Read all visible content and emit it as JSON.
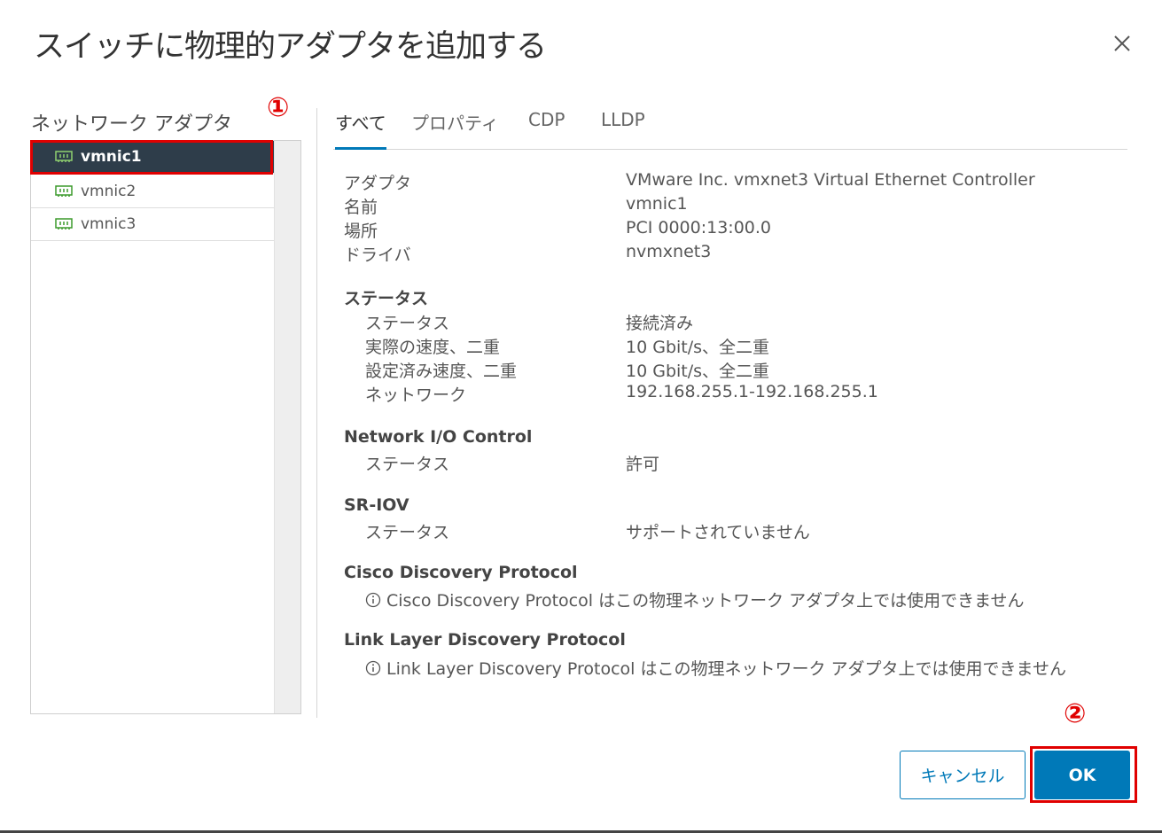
{
  "dialog": {
    "title": "スイッチに物理的アダプタを追加する"
  },
  "left": {
    "label": "ネットワーク アダプタ",
    "adapters": [
      {
        "name": "vmnic1",
        "selected": true
      },
      {
        "name": "vmnic2",
        "selected": false
      },
      {
        "name": "vmnic3",
        "selected": false
      }
    ]
  },
  "annotations": {
    "one": "①",
    "two": "②",
    "color": "#e00000"
  },
  "tabs": [
    "すべて",
    "プロパティ",
    "CDP",
    "LLDP"
  ],
  "details": {
    "general": [
      {
        "k": "アダプタ",
        "v": "VMware Inc. vmxnet3 Virtual Ethernet Controller"
      },
      {
        "k": "名前",
        "v": "vmnic1"
      },
      {
        "k": "場所",
        "v": "PCI 0000:13:00.0"
      },
      {
        "k": "ドライバ",
        "v": "nvmxnet3"
      }
    ],
    "status_title": "ステータス",
    "status": [
      {
        "k": "ステータス",
        "v": "接続済み"
      },
      {
        "k": "実際の速度、二重",
        "v": "10 Gbit/s、全二重"
      },
      {
        "k": "設定済み速度、二重",
        "v": "10 Gbit/s、全二重"
      },
      {
        "k": "ネットワーク",
        "v": "192.168.255.1-192.168.255.1"
      }
    ],
    "nioc_title": "Network I/O Control",
    "nioc": {
      "k": "ステータス",
      "v": "許可"
    },
    "sriov_title": "SR-IOV",
    "sriov": {
      "k": "ステータス",
      "v": "サポートされていません"
    },
    "cdp_title": "Cisco Discovery Protocol",
    "cdp_note": "Cisco Discovery Protocol はこの物理ネットワーク アダプタ上では使用できません",
    "lldp_title": "Link Layer Discovery Protocol",
    "lldp_note": "Link Layer Discovery Protocol はこの物理ネットワーク アダプタ上では使用できません"
  },
  "buttons": {
    "cancel": "キャンセル",
    "ok": "OK"
  },
  "colors": {
    "accent": "#0079b8",
    "selected_bg": "#2e3d4a",
    "nic_icon": "#3c9a2c"
  }
}
